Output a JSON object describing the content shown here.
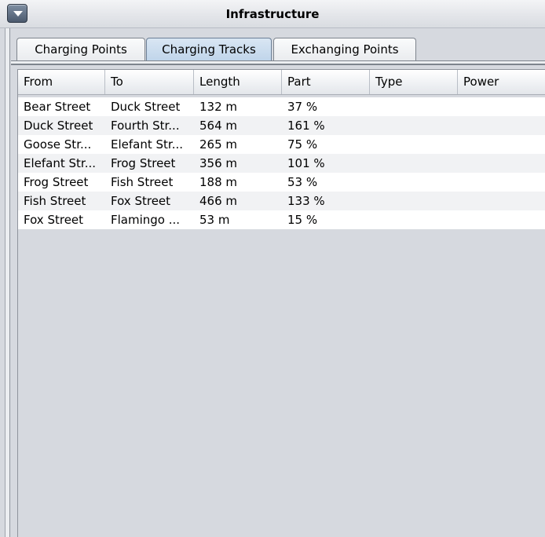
{
  "window": {
    "title": "Infrastructure",
    "menu_icon": "chevron-down-icon"
  },
  "tabs": [
    {
      "label": "Charging Points",
      "active": false
    },
    {
      "label": "Charging Tracks",
      "active": true
    },
    {
      "label": "Exchanging Points",
      "active": false
    }
  ],
  "table": {
    "columns": [
      "From",
      "To",
      "Length",
      "Part",
      "Type",
      "Power"
    ],
    "rows": [
      [
        "Bear Street",
        "Duck Street",
        "132 m",
        "37 %",
        "",
        ""
      ],
      [
        "Duck Street",
        "Fourth Str...",
        "564 m",
        "161 %",
        "",
        ""
      ],
      [
        "Goose Str...",
        "Elefant Str...",
        "265 m",
        "75 %",
        "",
        ""
      ],
      [
        "Elefant Str...",
        "Frog Street",
        "356 m",
        "101 %",
        "",
        ""
      ],
      [
        "Frog Street",
        "Fish Street",
        "188 m",
        "53 %",
        "",
        ""
      ],
      [
        "Fish Street",
        "Fox Street",
        "466 m",
        "133 %",
        "",
        ""
      ],
      [
        "Fox Street",
        "Flamingo ...",
        "53 m",
        "15 %",
        "",
        ""
      ]
    ]
  }
}
